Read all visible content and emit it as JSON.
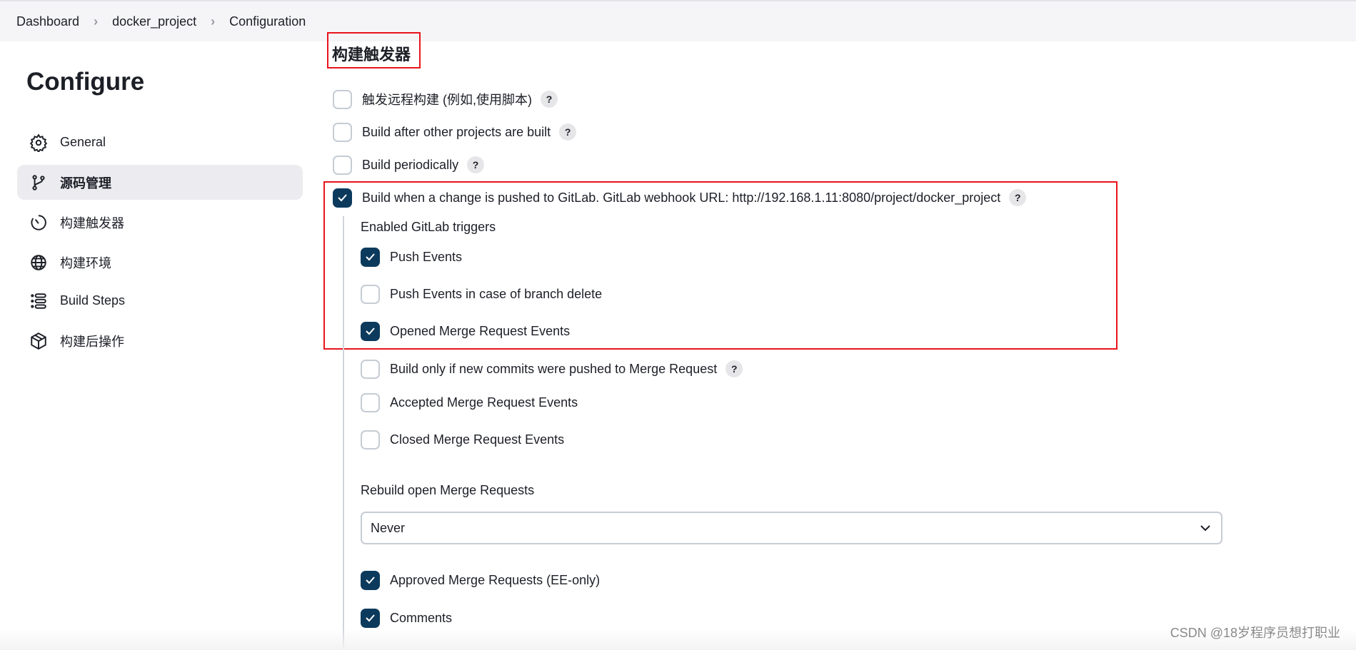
{
  "breadcrumb": [
    "Dashboard",
    "docker_project",
    "Configuration"
  ],
  "page_title": "Configure",
  "sidebar": {
    "items": [
      {
        "label": "General",
        "icon": "gear-icon"
      },
      {
        "label": "源码管理",
        "icon": "branch-icon",
        "active": true
      },
      {
        "label": "构建触发器",
        "icon": "timer-icon"
      },
      {
        "label": "构建环境",
        "icon": "globe-icon"
      },
      {
        "label": "Build Steps",
        "icon": "list-icon"
      },
      {
        "label": "构建后操作",
        "icon": "package-icon"
      }
    ]
  },
  "section": {
    "title": "构建触发器",
    "triggers": [
      {
        "label": "触发远程构建 (例如,使用脚本)",
        "checked": false,
        "help": "?"
      },
      {
        "label": "Build after other projects are built",
        "checked": false,
        "help": "?"
      },
      {
        "label": "Build periodically",
        "checked": false,
        "help": "?"
      },
      {
        "label": "Build when a change is pushed to GitLab. GitLab webhook URL: http://192.168.1.11:8080/project/docker_project",
        "checked": true,
        "help": "?"
      }
    ],
    "gitlab": {
      "enabled_label": "Enabled GitLab triggers",
      "options": [
        {
          "label": "Push Events",
          "checked": true
        },
        {
          "label": "Push Events in case of branch delete",
          "checked": false
        },
        {
          "label": "Opened Merge Request Events",
          "checked": true
        },
        {
          "label": "Build only if new commits were pushed to Merge Request",
          "checked": false,
          "help": "?"
        },
        {
          "label": "Accepted Merge Request Events",
          "checked": false
        },
        {
          "label": "Closed Merge Request Events",
          "checked": false
        }
      ],
      "rebuild_label": "Rebuild open Merge Requests",
      "rebuild_value": "Never",
      "more": [
        {
          "label": "Approved Merge Requests (EE-only)",
          "checked": true
        },
        {
          "label": "Comments",
          "checked": true
        }
      ]
    }
  },
  "watermark": "CSDN @18岁程序员想打职业",
  "colors": {
    "checked": "#0c3a5c",
    "highlight": "#e8141c"
  }
}
